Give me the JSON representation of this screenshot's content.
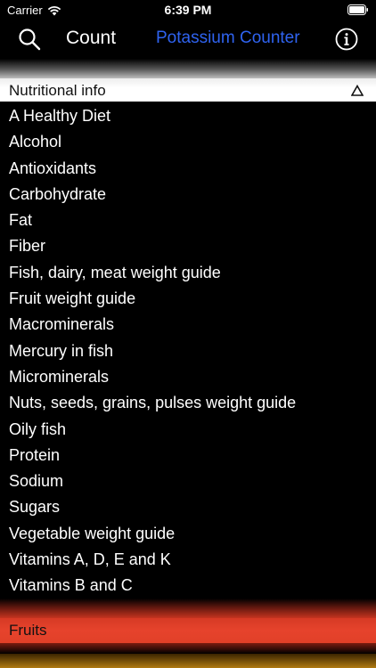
{
  "status_bar": {
    "carrier": "Carrier",
    "time": "6:39 PM"
  },
  "nav": {
    "count_label": "Count",
    "title": "Potassium Counter",
    "title_color": "#2f63f0"
  },
  "icons": {
    "search": "search-icon",
    "info": "info-icon",
    "collapse": "triangle-up-icon",
    "wifi": "wifi-icon",
    "battery": "battery-icon"
  },
  "section": {
    "header": "Nutritional info",
    "items": [
      "A Healthy Diet",
      "Alcohol",
      "Antioxidants",
      "Carbohydrate",
      "Fat",
      "Fiber",
      "Fish, dairy, meat weight guide",
      "Fruit weight guide",
      "Macrominerals",
      "Mercury in fish",
      "Microminerals",
      "Nuts, seeds, grains, pulses weight guide",
      "Oily fish",
      "Protein",
      "Sodium",
      "Sugars",
      "Vegetable weight guide",
      "Vitamins A, D, E and K",
      "Vitamins B and C"
    ]
  },
  "next_section": {
    "header": "Fruits",
    "color": "#e6432c"
  }
}
